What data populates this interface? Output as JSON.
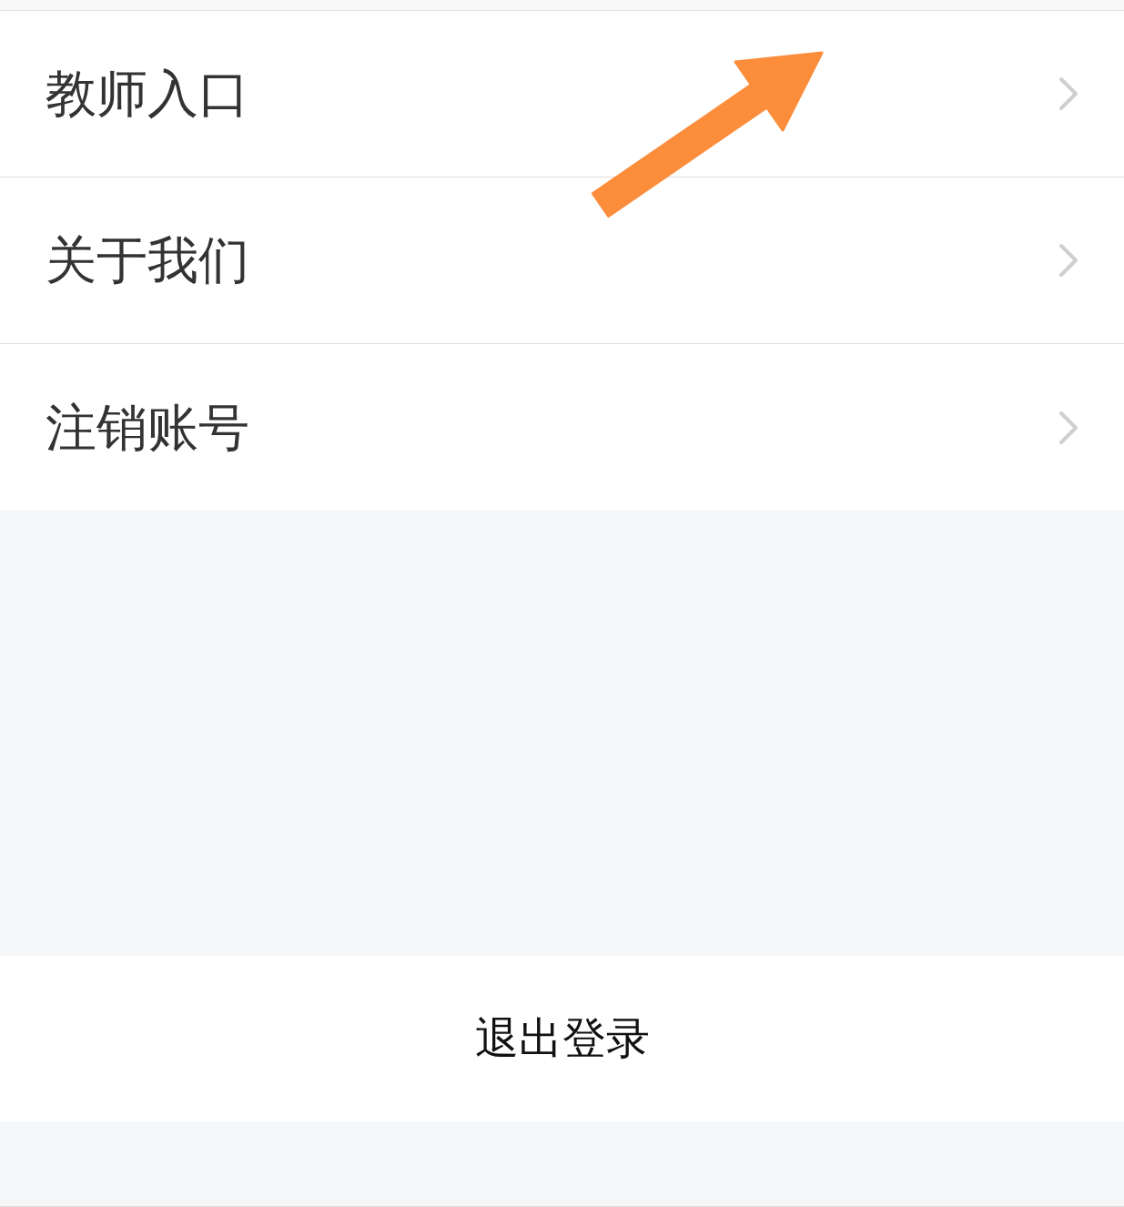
{
  "menu": {
    "items": [
      {
        "label": "教师入口"
      },
      {
        "label": "关于我们"
      },
      {
        "label": "注销账号"
      }
    ]
  },
  "logout_button": {
    "label": "退出登录"
  }
}
